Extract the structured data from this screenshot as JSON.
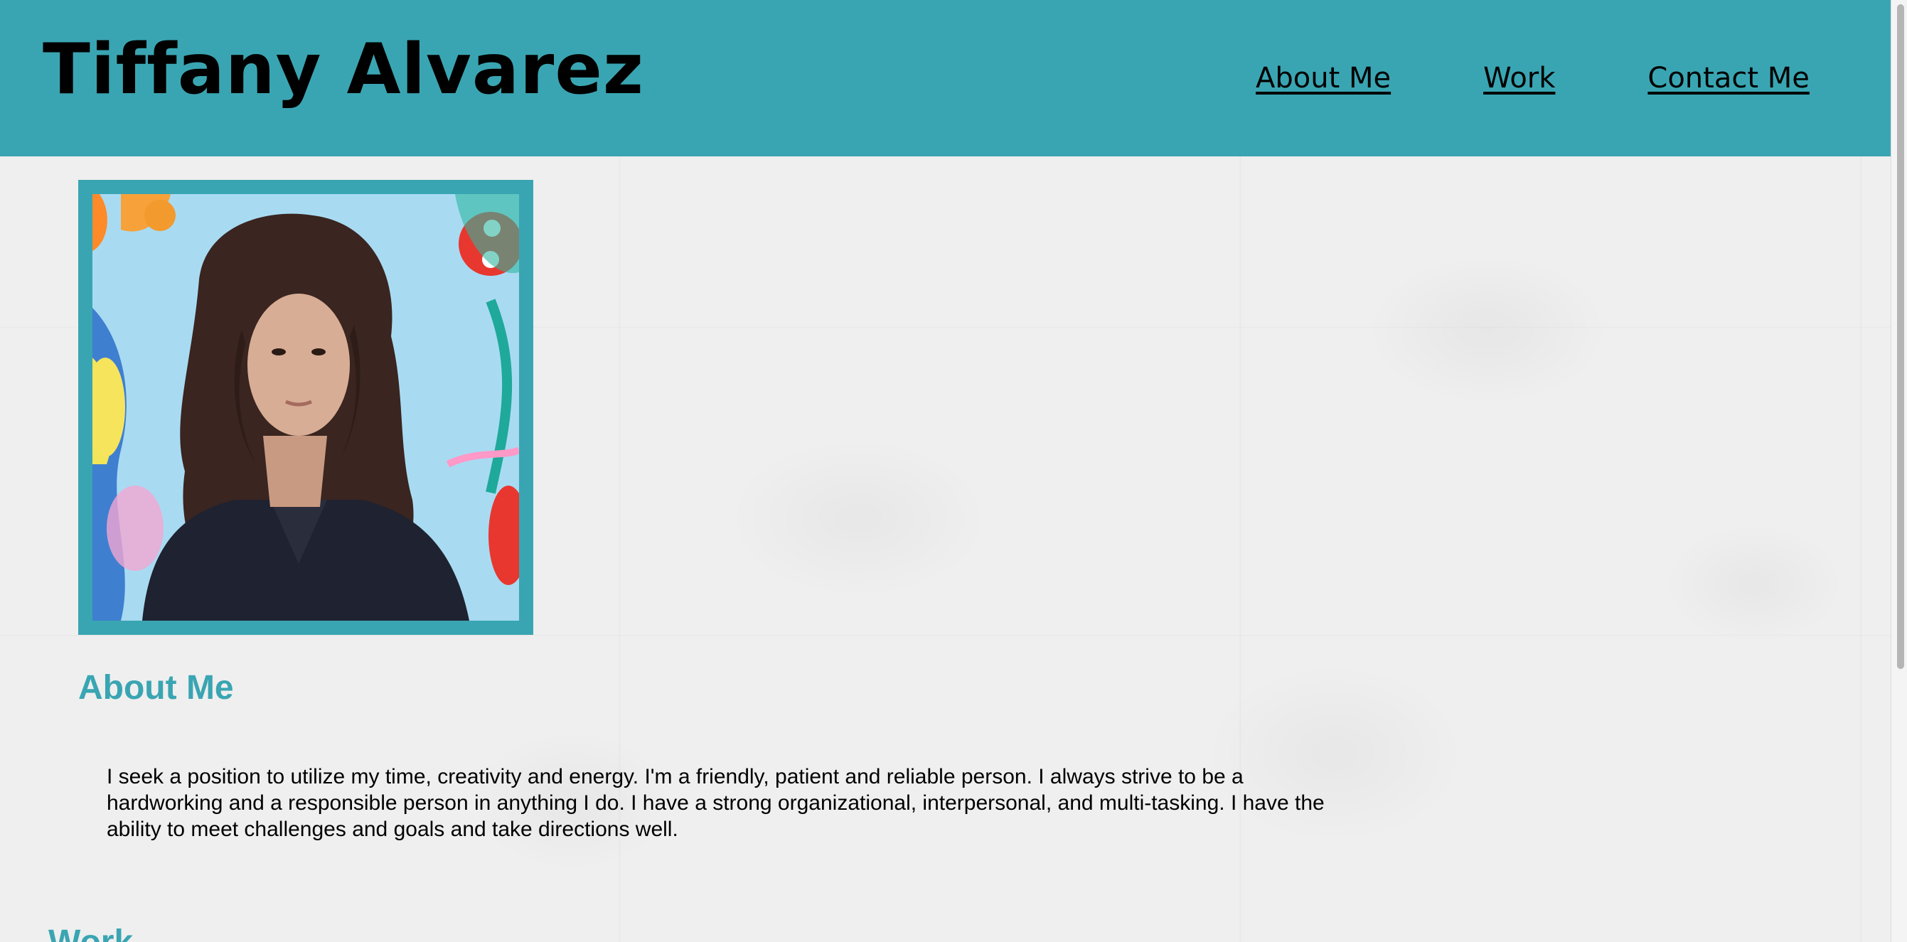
{
  "header": {
    "title": "Tiffany Alvarez",
    "background_color": "#3aa5b2"
  },
  "nav": {
    "items": [
      {
        "label": "About Me"
      },
      {
        "label": "Work"
      },
      {
        "label": "Contact Me"
      }
    ]
  },
  "profile_photo": {
    "frame_color": "#3aa5b2"
  },
  "about": {
    "heading": "About Me",
    "text": "I seek a position to utilize my time, creativity and energy. I'm a friendly, patient and reliable person. I always strive to be a hardworking and a responsible person in anything I do. I have a strong organizational, interpersonal, and multi-tasking. I have the ability to meet challenges and goals and take directions well."
  },
  "work": {
    "heading": "Work"
  },
  "colors": {
    "accent": "#3aa5b2",
    "text": "#000000",
    "page_background": "#efefef"
  }
}
